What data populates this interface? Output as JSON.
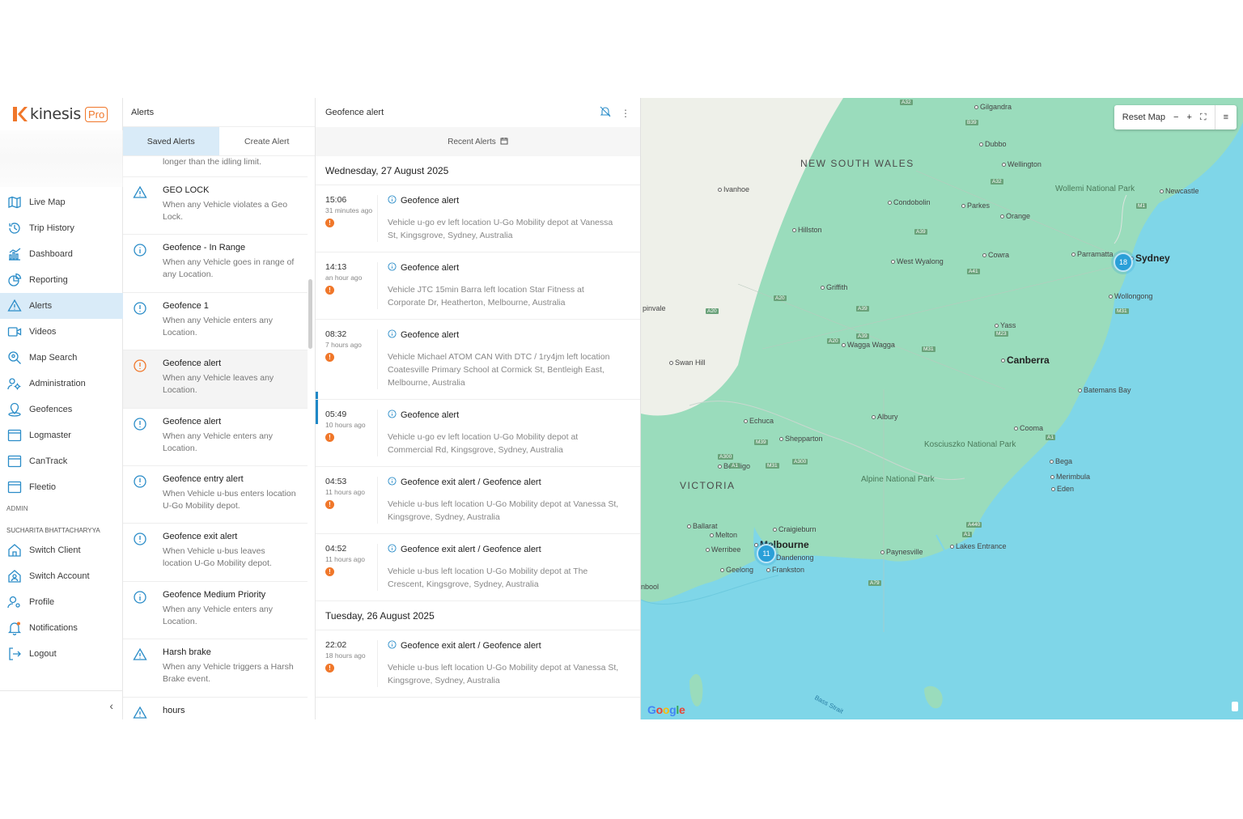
{
  "brand": {
    "name": "kinesis",
    "badge": "Pro"
  },
  "nav": [
    {
      "label": "Live Map",
      "icon": "map-icon"
    },
    {
      "label": "Trip History",
      "icon": "history-icon"
    },
    {
      "label": "Dashboard",
      "icon": "dashboard-icon"
    },
    {
      "label": "Reporting",
      "icon": "reporting-icon"
    },
    {
      "label": "Alerts",
      "icon": "alert-triangle-icon"
    },
    {
      "label": "Videos",
      "icon": "video-icon"
    },
    {
      "label": "Map Search",
      "icon": "map-search-icon"
    },
    {
      "label": "Administration",
      "icon": "administration-icon"
    },
    {
      "label": "Geofences",
      "icon": "geofence-icon"
    },
    {
      "label": "Logmaster",
      "icon": "logmaster-icon"
    },
    {
      "label": "CanTrack",
      "icon": "cantrack-icon"
    },
    {
      "label": "Fleetio",
      "icon": "fleetio-icon"
    }
  ],
  "admin_label": "ADMIN",
  "user_name": "SUCHARITA BHATTACHARYYA",
  "account_nav": [
    {
      "label": "Switch Client",
      "icon": "home-icon"
    },
    {
      "label": "Switch Account",
      "icon": "switch-account-icon"
    },
    {
      "label": "Profile",
      "icon": "profile-icon"
    },
    {
      "label": "Notifications",
      "icon": "bell-icon"
    },
    {
      "label": "Logout",
      "icon": "logout-icon"
    }
  ],
  "alerts_panel": {
    "title": "Alerts",
    "tabs": [
      "Saved Alerts",
      "Create Alert"
    ],
    "top_fragment": "longer than the idling limit.",
    "items": [
      {
        "name": "GEO LOCK",
        "desc": "When any Vehicle violates a Geo Lock.",
        "icon": "warning-triangle-icon"
      },
      {
        "name": "Geofence - In Range",
        "desc": "When any Vehicle goes in range of any Location.",
        "icon": "info-circle-icon"
      },
      {
        "name": "Geofence 1",
        "desc": "When any Vehicle enters any Location.",
        "icon": "exclamation-circle-icon"
      },
      {
        "name": "Geofence alert",
        "desc": "When any Vehicle leaves any Location.",
        "icon": "exclamation-circle-orange-icon"
      },
      {
        "name": "Geofence alert",
        "desc": "When any Vehicle enters any Location.",
        "icon": "exclamation-circle-icon"
      },
      {
        "name": "Geofence entry alert",
        "desc": "When Vehicle u-bus enters location U-Go Mobility depot.",
        "icon": "exclamation-circle-icon"
      },
      {
        "name": "Geofence exit alert",
        "desc": "When Vehicle u-bus leaves location U-Go Mobility depot.",
        "icon": "exclamation-circle-icon"
      },
      {
        "name": "Geofence Medium Priority",
        "desc": "When any Vehicle enters any Location.",
        "icon": "info-circle-icon"
      },
      {
        "name": "Harsh brake",
        "desc": "When any Vehicle triggers a Harsh Brake event.",
        "icon": "warning-triangle-icon"
      },
      {
        "name": "hours",
        "desc": "",
        "icon": "warning-triangle-icon"
      }
    ]
  },
  "detail": {
    "title": "Geofence alert",
    "recent_label": "Recent Alerts",
    "groups": [
      {
        "date": "Wednesday, 27 August 2025",
        "events": [
          {
            "time": "15:06",
            "ago": "31 minutes ago",
            "title": "Geofence alert",
            "message": "Vehicle u-go ev left location U-Go Mobility depot at Vanessa St, Kingsgrove, Sydney, Australia"
          },
          {
            "time": "14:13",
            "ago": "an hour ago",
            "title": "Geofence alert",
            "message": "Vehicle JTC 15min Barra left location Star Fitness at Corporate Dr, Heatherton, Melbourne, Australia"
          },
          {
            "time": "08:32",
            "ago": "7 hours ago",
            "title": "Geofence alert",
            "message": "Vehicle Michael ATOM CAN With DTC / 1ry4jm left location Coatesville Primary School at Cormick St, Bentleigh East, Melbourne, Australia"
          },
          {
            "time": "05:49",
            "ago": "10 hours ago",
            "title": "Geofence alert",
            "message": "Vehicle u-go ev left location U-Go Mobility depot at Commercial Rd, Kingsgrove, Sydney, Australia"
          },
          {
            "time": "04:53",
            "ago": "11 hours ago",
            "title": "Geofence exit alert / Geofence alert",
            "message": "Vehicle u-bus left location U-Go Mobility depot at Vanessa St, Kingsgrove, Sydney, Australia"
          },
          {
            "time": "04:52",
            "ago": "11 hours ago",
            "title": "Geofence exit alert / Geofence alert",
            "message": "Vehicle u-bus left location U-Go Mobility depot at The Crescent, Kingsgrove, Sydney, Australia"
          }
        ]
      },
      {
        "date": "Tuesday, 26 August 2025",
        "events": [
          {
            "time": "22:02",
            "ago": "18 hours ago",
            "title": "Geofence exit alert / Geofence alert",
            "message": "Vehicle u-bus left location U-Go Mobility depot at Vanessa St, Kingsgrove, Sydney, Australia"
          }
        ]
      }
    ]
  },
  "map": {
    "reset_label": "Reset Map",
    "states": [
      "NEW SOUTH WALES",
      "VICTORIA"
    ],
    "cities": [
      "Gilgandra",
      "Dubbo",
      "Wellington",
      "Ivanhoe",
      "Condobolin",
      "Parkes",
      "Orange",
      "Newcastle",
      "Hillston",
      "West Wyalong",
      "Cowra",
      "Parramatta",
      "Sydney",
      "Wollongong",
      "Griffith",
      "Yass",
      "Wagga Wagga",
      "Canberra",
      "Swan Hill",
      "Albury",
      "Batemans Bay",
      "Echuca",
      "Shepparton",
      "Cooma",
      "Bendigo",
      "Bega",
      "Merimbula",
      "Eden",
      "Ballarat",
      "Melton",
      "Craigieburn",
      "Melbourne",
      "Werribee",
      "Dandenong",
      "Geelong",
      "Frankston",
      "Paynesville",
      "Lakes Entrance"
    ],
    "parks": [
      "Wollemi National Park",
      "Kosciuszko National Park",
      "Alpine National Park"
    ],
    "clusters": [
      {
        "label": "18",
        "city": "Sydney"
      },
      {
        "label": "11",
        "city": "Melbourne"
      }
    ],
    "roads": [
      "A32",
      "B39",
      "A32",
      "M1",
      "A39",
      "A41",
      "A20",
      "A20",
      "A39",
      "M31",
      "A39",
      "A20",
      "M23",
      "M31",
      "A300",
      "M39",
      "M31",
      "A300",
      "A1",
      "A1",
      "A1",
      "A440",
      "A79"
    ],
    "partial_labels": [
      "pinvale",
      "nbool"
    ],
    "attribution": "Google",
    "water_label": "Bass Strait"
  },
  "colors": {
    "accent": "#2a9fd8",
    "active_bg": "#d9ebf8",
    "brand_orange": "#f0772a",
    "land": "#8fd9b4",
    "water": "#7fd6e8"
  }
}
